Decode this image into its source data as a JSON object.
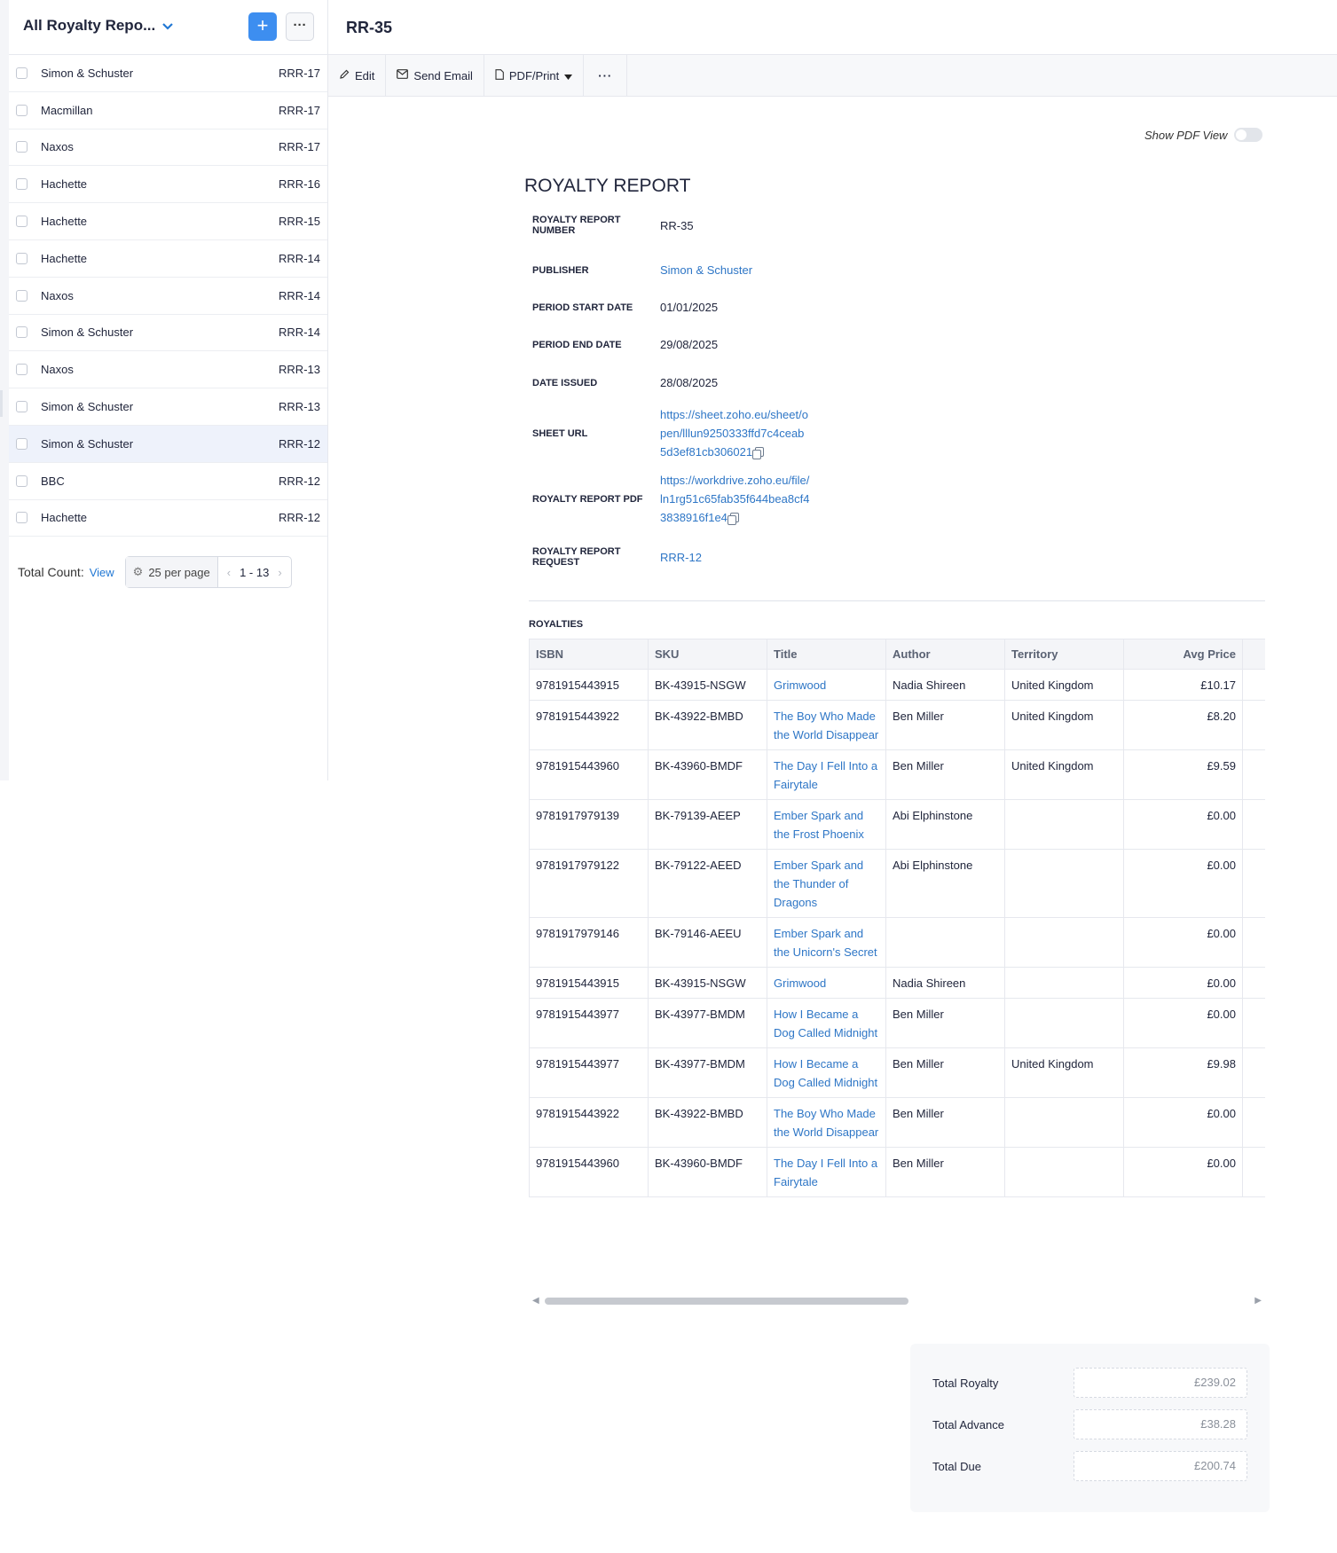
{
  "list": {
    "title": "All Royalty Repo...",
    "add_label": "+",
    "more_label": "···",
    "rows": [
      {
        "name": "Simon & Schuster",
        "code": "RRR-17"
      },
      {
        "name": "Macmillan",
        "code": "RRR-17"
      },
      {
        "name": "Naxos",
        "code": "RRR-17"
      },
      {
        "name": "Hachette",
        "code": "RRR-16"
      },
      {
        "name": "Hachette",
        "code": "RRR-15"
      },
      {
        "name": "Hachette",
        "code": "RRR-14"
      },
      {
        "name": "Naxos",
        "code": "RRR-14"
      },
      {
        "name": "Simon & Schuster",
        "code": "RRR-14"
      },
      {
        "name": "Naxos",
        "code": "RRR-13"
      },
      {
        "name": "Simon & Schuster",
        "code": "RRR-13"
      },
      {
        "name": "Simon & Schuster",
        "code": "RRR-12",
        "selected": true
      },
      {
        "name": "BBC",
        "code": "RRR-12"
      },
      {
        "name": "Hachette",
        "code": "RRR-12"
      }
    ],
    "footer": {
      "total_label": "Total Count:",
      "view_label": "View",
      "per_page": "25 per page",
      "range": "1 - 13"
    }
  },
  "record": {
    "title": "RR-35",
    "toolbar": {
      "edit": "Edit",
      "send_email": "Send Email",
      "pdf_print": "PDF/Print",
      "more": "···"
    },
    "show_pdf_view_label": "Show PDF View",
    "report_title": "ROYALTY REPORT",
    "fields": {
      "number_label": "ROYALTY REPORT NUMBER",
      "number_value": "RR-35",
      "publisher_label": "PUBLISHER",
      "publisher_value": "Simon & Schuster",
      "start_label": "PERIOD START DATE",
      "start_value": "01/01/2025",
      "end_label": "PERIOD END DATE",
      "end_value": "29/08/2025",
      "issued_label": "DATE ISSUED",
      "issued_value": "28/08/2025",
      "sheet_label": "SHEET URL",
      "sheet_line1": "https://sheet.zoho.eu/sheet/o",
      "sheet_line2": "pen/lllun9250333ffd7c4ceab",
      "sheet_line3": "5d3ef81cb306021",
      "pdf_label": "ROYALTY REPORT PDF",
      "pdf_line1": "https://workdrive.zoho.eu/file/",
      "pdf_line2": "ln1rg51c65fab35f644bea8cf4",
      "pdf_line3": "3838916f1e4",
      "request_label": "ROYALTY REPORT REQUEST",
      "request_value": "RRR-12"
    },
    "royalties": {
      "section_title": "ROYALTIES",
      "columns": [
        "ISBN",
        "SKU",
        "Title",
        "Author",
        "Territory",
        "Avg Price"
      ],
      "rows": [
        {
          "isbn": "9781915443915",
          "sku": "BK-43915-NSGW",
          "title": "Grimwood",
          "author": "Nadia Shireen",
          "territory": "United Kingdom",
          "avg_price": "£10.17"
        },
        {
          "isbn": "9781915443922",
          "sku": "BK-43922-BMBD",
          "title": "The Boy Who Made the World Disappear",
          "author": "Ben Miller",
          "territory": "United Kingdom",
          "avg_price": "£8.20"
        },
        {
          "isbn": "9781915443960",
          "sku": "BK-43960-BMDF",
          "title": "The Day I Fell Into a Fairytale",
          "author": "Ben Miller",
          "territory": "United Kingdom",
          "avg_price": "£9.59"
        },
        {
          "isbn": "9781917979139",
          "sku": "BK-79139-AEEP",
          "title": "Ember Spark and the Frost Phoenix",
          "author": "Abi Elphinstone",
          "territory": "",
          "avg_price": "£0.00"
        },
        {
          "isbn": "9781917979122",
          "sku": "BK-79122-AEED",
          "title": "Ember Spark and the Thunder of Dragons",
          "author": "Abi Elphinstone",
          "territory": "",
          "avg_price": "£0.00"
        },
        {
          "isbn": "9781917979146",
          "sku": "BK-79146-AEEU",
          "title": "Ember Spark and the Unicorn's Secret",
          "author": "",
          "territory": "",
          "avg_price": "£0.00"
        },
        {
          "isbn": "9781915443915",
          "sku": "BK-43915-NSGW",
          "title": "Grimwood",
          "author": "Nadia Shireen",
          "territory": "",
          "avg_price": "£0.00"
        },
        {
          "isbn": "9781915443977",
          "sku": "BK-43977-BMDM",
          "title": "How I Became a Dog Called Midnight",
          "author": "Ben Miller",
          "territory": "",
          "avg_price": "£0.00"
        },
        {
          "isbn": "9781915443977",
          "sku": "BK-43977-BMDM",
          "title": "How I Became a Dog Called Midnight",
          "author": "Ben Miller",
          "territory": "United Kingdom",
          "avg_price": "£9.98"
        },
        {
          "isbn": "9781915443922",
          "sku": "BK-43922-BMBD",
          "title": "The Boy Who Made the World Disappear",
          "author": "Ben Miller",
          "territory": "",
          "avg_price": "£0.00"
        },
        {
          "isbn": "9781915443960",
          "sku": "BK-43960-BMDF",
          "title": "The Day I Fell Into a Fairytale",
          "author": "Ben Miller",
          "territory": "",
          "avg_price": "£0.00"
        }
      ]
    },
    "totals": {
      "royalty_label": "Total Royalty",
      "royalty_value": "£239.02",
      "advance_label": "Total Advance",
      "advance_value": "£38.28",
      "due_label": "Total Due",
      "due_value": "£200.74"
    }
  }
}
